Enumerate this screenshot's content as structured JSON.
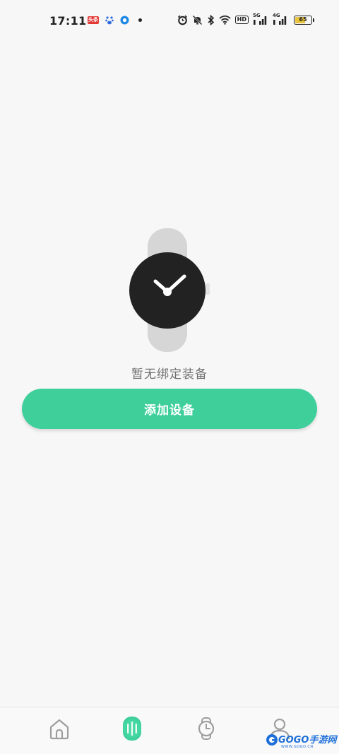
{
  "status_bar": {
    "time": "17:11",
    "news_badge": "头条",
    "network_label_1": "5G",
    "network_label_2": "4G",
    "hd_label": "HD",
    "battery_level": "65",
    "icons": [
      "news-icon",
      "baidu-paw-icon",
      "app-ring-icon",
      "notification-dot-icon",
      "alarm-icon",
      "mute-icon",
      "bluetooth-icon",
      "wifi-icon",
      "hd-icon",
      "signal-icon",
      "signal-icon",
      "battery-icon"
    ]
  },
  "empty_state": {
    "message": "暂无绑定装备",
    "illustration": "watch-icon"
  },
  "actions": {
    "add_device_label": "添加设备"
  },
  "bottom_nav": {
    "items": [
      {
        "icon": "home-icon",
        "active": false
      },
      {
        "icon": "device-icon",
        "active": true
      },
      {
        "icon": "watch-icon",
        "active": false
      },
      {
        "icon": "profile-icon",
        "active": false
      }
    ],
    "accent_color": "#3ecf9b"
  },
  "watermark": {
    "text": "GOGO手游网",
    "sub": "WWW.GOGO.CN"
  },
  "colors": {
    "background": "#f7f7f7",
    "primary": "#3ecf9b",
    "watch_face": "#222222",
    "watch_band": "#d6d6d6"
  }
}
